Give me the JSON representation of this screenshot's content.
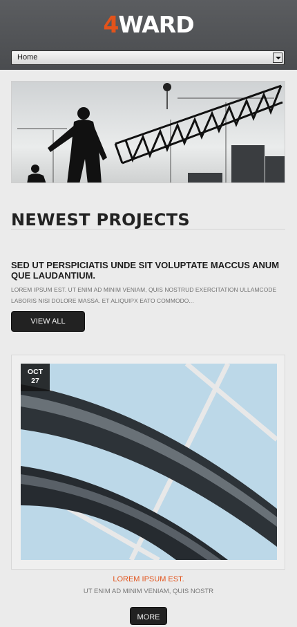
{
  "header": {
    "logo_accent": "4",
    "logo_text": "WARD",
    "nav_selected": "Home"
  },
  "section": {
    "title": "NEWEST PROJECTS",
    "subtitle": "SED UT PERSPICIATIS UNDE SIT VOLUPTATE MACCUS ANUM QUE LAUDANTIUM.",
    "body": "LOREM IPSUM EST. UT ENIM AD MINIM VENIAM, QUIS NOSTRUD EXERCITATION ULLAMCODE LABORIS NISI DOLORE MASSA. ET ALIQUIPX EATO COMMODO...",
    "view_all_label": "VIEW ALL"
  },
  "card": {
    "date_month": "OCT",
    "date_day": "27",
    "link_text": "LOREM IPSUM EST.",
    "text": "UT ENIM AD MINIM VENIAM, QUIS NOSTR",
    "more_label": "MORE"
  },
  "colors": {
    "accent": "#e2531b",
    "header_bg": "#55575a",
    "button_bg": "#222222"
  }
}
